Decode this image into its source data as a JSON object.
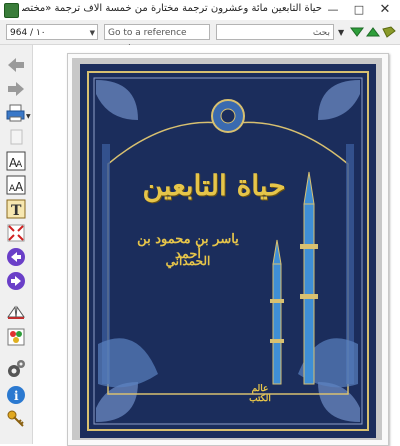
{
  "window": {
    "title": "حياة التابعين مائة وعشرون ترجمة مختارة من خمسة آلاف ترجمة «مختصر سير أعلام النبلاء للإمام الذه",
    "minimize_icon": "minimize-icon",
    "maximize_icon": "maximize-icon",
    "close_icon": "close-icon"
  },
  "toolbar": {
    "page_value": "964 / ١٠",
    "reference_placeholder": "Go to a reference number....",
    "search_placeholder": "بحث",
    "colors": {
      "green": "#2e9e3a",
      "olive": "#8a9a2a"
    }
  },
  "book": {
    "title": "حياة التابعين",
    "author_line1": "ياسر بن محمود بن أحمد",
    "author_line2": "الحمداني",
    "publisher_mark": "عالم الكتب",
    "colors": {
      "cover": "#1b2d5c",
      "gold": "#e6c54a",
      "blue": "#3f8fd6"
    }
  }
}
